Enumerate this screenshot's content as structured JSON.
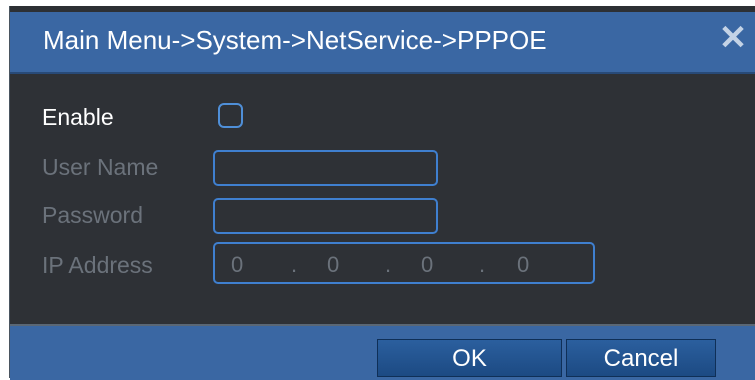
{
  "dialog": {
    "title": "Main Menu->System->NetService->PPPOE",
    "close_icon": "close-icon"
  },
  "form": {
    "enable_label": "Enable",
    "enable_checked": false,
    "username_label": "User Name",
    "username_value": "",
    "password_label": "Password",
    "password_value": "",
    "ip_label": "IP Address",
    "ip_octets": [
      "0",
      "0",
      "0",
      "0"
    ],
    "ip_separator": "."
  },
  "buttons": {
    "ok_label": "OK",
    "cancel_label": "Cancel"
  },
  "colors": {
    "titlebar": "#3a67a3",
    "panel": "#2e3136",
    "field_border": "#3f7fcf",
    "disabled_text": "#6b727b"
  }
}
